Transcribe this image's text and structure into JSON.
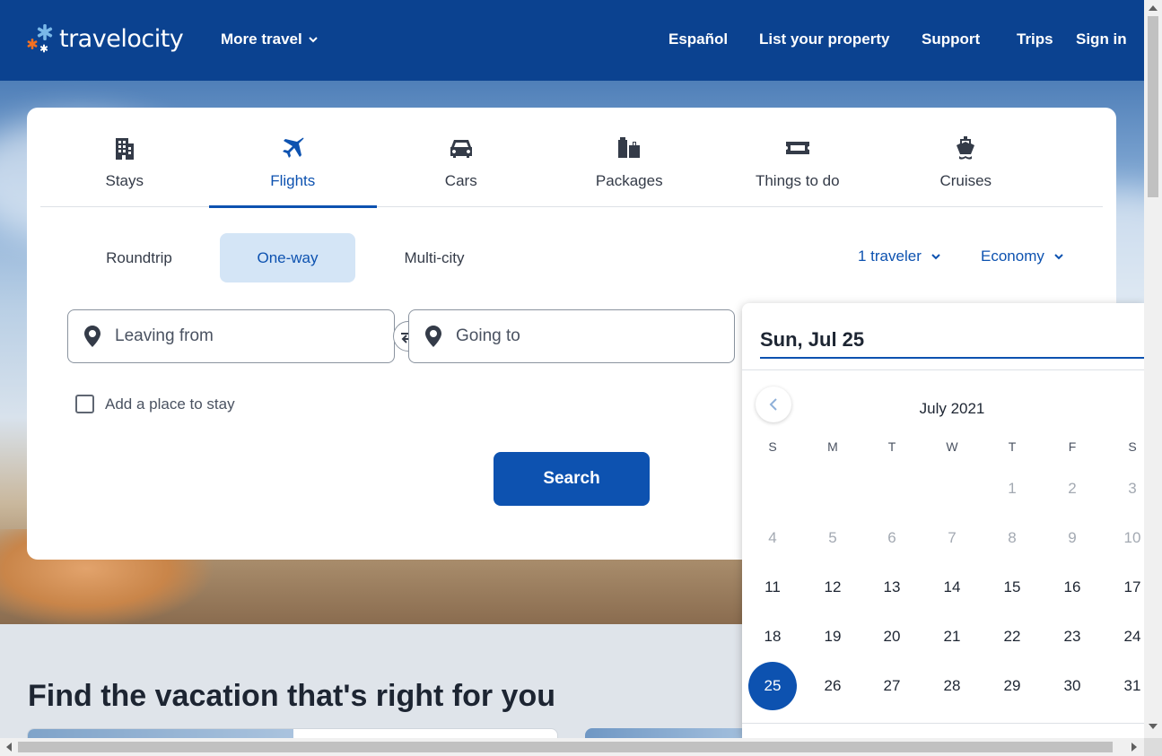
{
  "header": {
    "logo_text": "travelocity",
    "more_travel_label": "More travel",
    "nav": [
      "Español",
      "List your property",
      "Support",
      "Trips",
      "Sign in"
    ]
  },
  "tabs": [
    {
      "label": "Stays",
      "icon": "building-icon"
    },
    {
      "label": "Flights",
      "icon": "airplane-icon"
    },
    {
      "label": "Cars",
      "icon": "car-icon"
    },
    {
      "label": "Packages",
      "icon": "luggage-icon"
    },
    {
      "label": "Things to do",
      "icon": "ticket-icon"
    },
    {
      "label": "Cruises",
      "icon": "ship-icon"
    }
  ],
  "active_tab": "Flights",
  "trip_types": [
    "Roundtrip",
    "One-way",
    "Multi-city"
  ],
  "active_trip_type": "One-way",
  "travelers_label": "1 traveler",
  "cabin_label": "Economy",
  "leaving_from_placeholder": "Leaving from",
  "going_to_placeholder": "Going to",
  "add_place_label": "Add a place to stay",
  "search_label": "Search",
  "section_title": "Find the vacation that's right for you",
  "datepicker": {
    "selected_label": "Sun, Jul 25",
    "month_label": "July 2021",
    "weekdays": [
      "S",
      "M",
      "T",
      "W",
      "T",
      "F",
      "S"
    ],
    "rows": [
      [
        "",
        "",
        "",
        "",
        "1",
        "2",
        "3"
      ],
      [
        "4",
        "5",
        "6",
        "7",
        "8",
        "9",
        "10"
      ],
      [
        "11",
        "12",
        "13",
        "14",
        "15",
        "16",
        "17"
      ],
      [
        "18",
        "19",
        "20",
        "21",
        "22",
        "23",
        "24"
      ],
      [
        "25",
        "26",
        "27",
        "28",
        "29",
        "30",
        "31"
      ]
    ],
    "past_days_through": 10,
    "selected_day": "25"
  },
  "colors": {
    "brand_blue": "#0b4290",
    "accent_blue": "#0d52b0",
    "active_tab_bg": "#d4e5f6",
    "logo_orange": "#f37021",
    "logo_light_blue": "#7ab8e8"
  }
}
